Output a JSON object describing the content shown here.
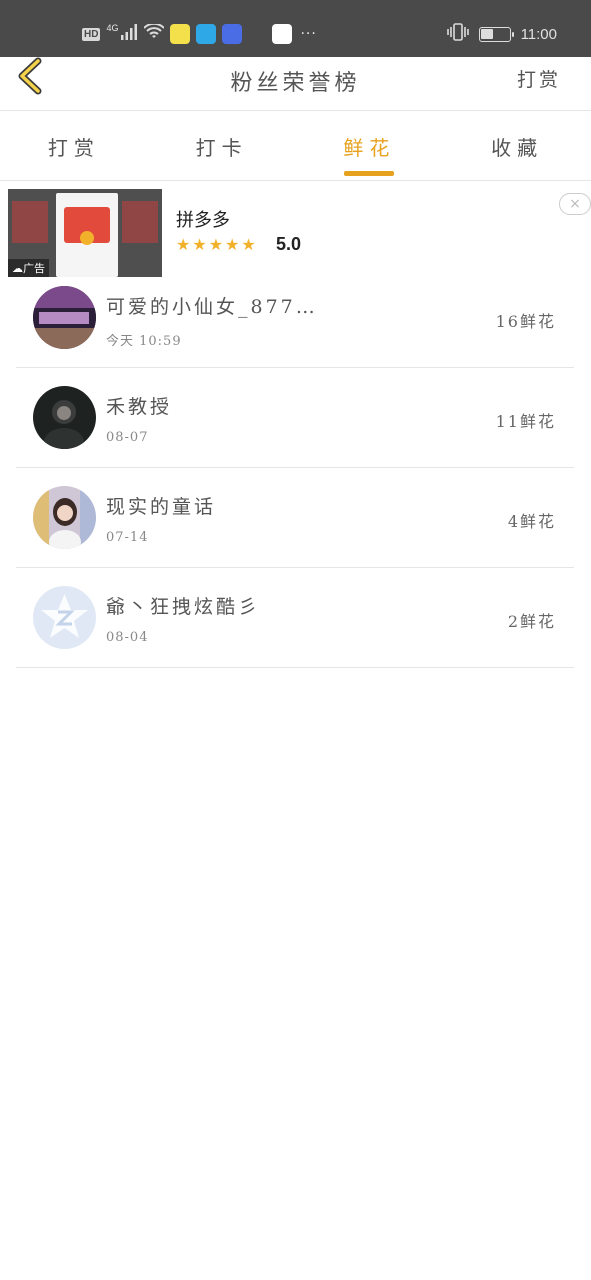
{
  "status_bar": {
    "hd": "HD",
    "network": "4G",
    "more": "···",
    "time": "11:00",
    "battery_level": 0.45
  },
  "header": {
    "title": "粉丝荣誉榜",
    "action": "打赏"
  },
  "tabs": [
    {
      "label": "打赏",
      "active": false
    },
    {
      "label": "打卡",
      "active": false
    },
    {
      "label": "鲜花",
      "active": true
    },
    {
      "label": "收藏",
      "active": false
    }
  ],
  "ad": {
    "label": "广告",
    "name": "拼多多",
    "stars": 5,
    "rating": "5.0",
    "close": "×"
  },
  "fans": [
    {
      "name": "可爱的小仙女_877…",
      "date": "今天 10:59",
      "count": "16鲜花",
      "avatar": "avatar-photo-girl"
    },
    {
      "name": "禾教授",
      "date": "08-07",
      "count": "11鲜花",
      "avatar": "avatar-photo-dark"
    },
    {
      "name": "现实的童话",
      "date": "07-14",
      "count": "4鲜花",
      "avatar": "avatar-photo-portrait"
    },
    {
      "name": "爺丶狂拽炫酷彡",
      "date": "08-04",
      "count": "2鲜花",
      "avatar": "avatar-default-qq"
    }
  ],
  "colors": {
    "accent": "#e6a21e",
    "status_bar": "#4a4a4a",
    "divider": "#e6e6e6"
  }
}
